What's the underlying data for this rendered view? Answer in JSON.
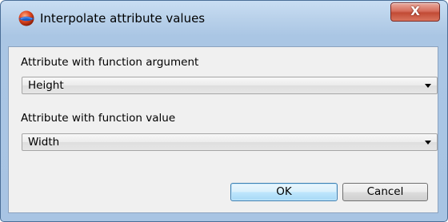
{
  "window": {
    "title": "Interpolate attribute values",
    "close_label": "X"
  },
  "icons": {
    "app": "app-logo-icon"
  },
  "form": {
    "argument_label": "Attribute with function argument",
    "argument_value": "Height",
    "value_label": "Attribute with function value",
    "value_value": "Width"
  },
  "buttons": {
    "ok_label": "OK",
    "cancel_label": "Cancel"
  },
  "colors": {
    "frame": "#a8c4e3",
    "client": "#f0f0f0",
    "close_button": "#c24b35",
    "default_button_border": "#3c7fb1"
  }
}
